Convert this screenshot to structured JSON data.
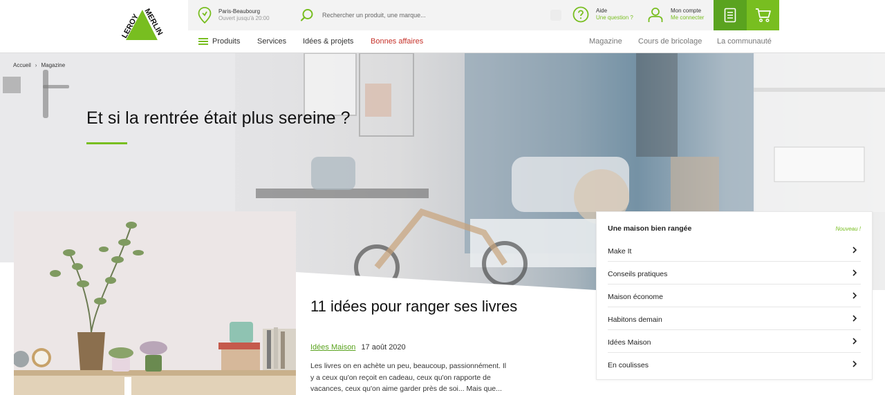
{
  "brand": {
    "logo_text_top": "LEROY",
    "logo_text_bottom": "MERLIN",
    "accent": "#78be20",
    "accent_dark": "#5aa31f",
    "promo": "#c6322a"
  },
  "topbar": {
    "store_name": "Paris-Beaubourg",
    "store_hours": "Ouvert jusqu'à 20:00",
    "search_placeholder": "Rechercher un produit, une marque...",
    "help_title": "Aide",
    "help_sub": "Une question ?",
    "account_title": "Mon compte",
    "account_sub": "Me connecter"
  },
  "nav": {
    "products": "Produits",
    "services": "Services",
    "ideas": "Idées & projets",
    "deals": "Bonnes affaires",
    "magazine": "Magazine",
    "courses": "Cours de bricolage",
    "community": "La communauté"
  },
  "breadcrumb": {
    "home": "Accueil",
    "current": "Magazine"
  },
  "hero": {
    "title": "Et si la rentrée était plus sereine ?"
  },
  "article": {
    "title": "11 idées pour ranger ses livres",
    "category": "Idées Maison",
    "date": "17 août 2020",
    "excerpt": "Les livres on en achète un peu, beaucoup, passionnément. Il y a ceux qu'on reçoit en cadeau, ceux qu'on rapporte de vacances, ceux qu'on aime garder près de soi... Mais que..."
  },
  "side_menu": {
    "header": "Une maison bien rangée",
    "badge": "Nouveau !",
    "items": [
      {
        "label": "Make It"
      },
      {
        "label": "Conseils pratiques"
      },
      {
        "label": "Maison économe"
      },
      {
        "label": "Habitons demain"
      },
      {
        "label": "Idées Maison"
      },
      {
        "label": "En coulisses"
      }
    ]
  }
}
